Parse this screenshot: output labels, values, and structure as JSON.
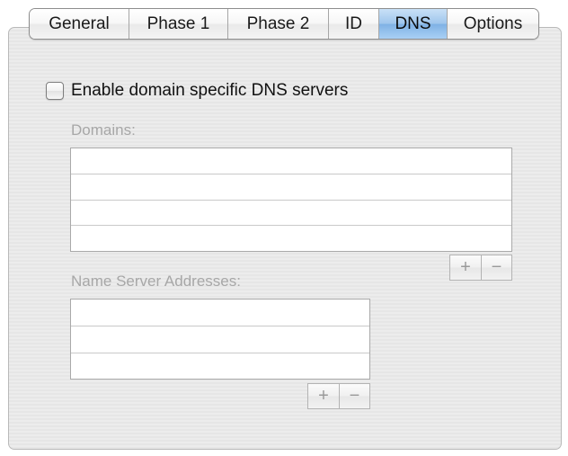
{
  "tabs": [
    {
      "label": "General",
      "selected": false
    },
    {
      "label": "Phase 1",
      "selected": false
    },
    {
      "label": "Phase 2",
      "selected": false
    },
    {
      "label": "ID",
      "selected": false
    },
    {
      "label": "DNS",
      "selected": true
    },
    {
      "label": "Options",
      "selected": false
    }
  ],
  "dns": {
    "enable_label": "Enable domain specific DNS servers",
    "enable_checked": false,
    "domains_label": "Domains:",
    "domains_rows": [
      "",
      "",
      "",
      ""
    ],
    "nameservers_label": "Name Server Addresses:",
    "nameservers_rows": [
      "",
      "",
      ""
    ],
    "add_symbol": "+",
    "remove_symbol": "−"
  },
  "colors": {
    "selected_tab": "#9ec5ec",
    "disabled_text": "#a7a7a7"
  }
}
